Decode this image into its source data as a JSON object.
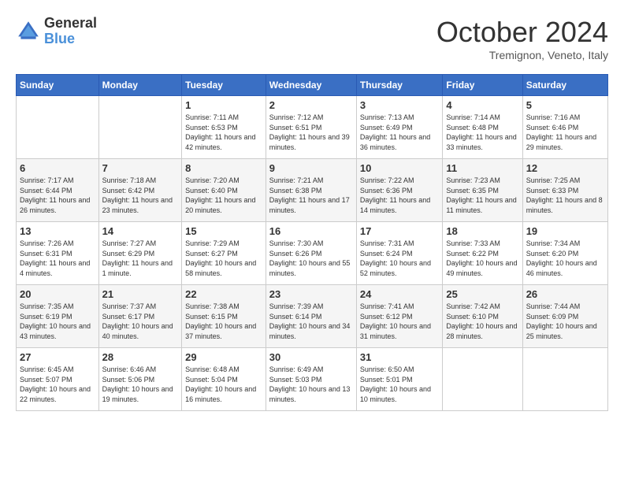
{
  "header": {
    "logo_general": "General",
    "logo_blue": "Blue",
    "title": "October 2024",
    "location": "Tremignon, Veneto, Italy"
  },
  "days_of_week": [
    "Sunday",
    "Monday",
    "Tuesday",
    "Wednesday",
    "Thursday",
    "Friday",
    "Saturday"
  ],
  "weeks": [
    [
      {
        "day": "",
        "sunrise": "",
        "sunset": "",
        "daylight": ""
      },
      {
        "day": "",
        "sunrise": "",
        "sunset": "",
        "daylight": ""
      },
      {
        "day": "1",
        "sunrise": "Sunrise: 7:11 AM",
        "sunset": "Sunset: 6:53 PM",
        "daylight": "Daylight: 11 hours and 42 minutes."
      },
      {
        "day": "2",
        "sunrise": "Sunrise: 7:12 AM",
        "sunset": "Sunset: 6:51 PM",
        "daylight": "Daylight: 11 hours and 39 minutes."
      },
      {
        "day": "3",
        "sunrise": "Sunrise: 7:13 AM",
        "sunset": "Sunset: 6:49 PM",
        "daylight": "Daylight: 11 hours and 36 minutes."
      },
      {
        "day": "4",
        "sunrise": "Sunrise: 7:14 AM",
        "sunset": "Sunset: 6:48 PM",
        "daylight": "Daylight: 11 hours and 33 minutes."
      },
      {
        "day": "5",
        "sunrise": "Sunrise: 7:16 AM",
        "sunset": "Sunset: 6:46 PM",
        "daylight": "Daylight: 11 hours and 29 minutes."
      }
    ],
    [
      {
        "day": "6",
        "sunrise": "Sunrise: 7:17 AM",
        "sunset": "Sunset: 6:44 PM",
        "daylight": "Daylight: 11 hours and 26 minutes."
      },
      {
        "day": "7",
        "sunrise": "Sunrise: 7:18 AM",
        "sunset": "Sunset: 6:42 PM",
        "daylight": "Daylight: 11 hours and 23 minutes."
      },
      {
        "day": "8",
        "sunrise": "Sunrise: 7:20 AM",
        "sunset": "Sunset: 6:40 PM",
        "daylight": "Daylight: 11 hours and 20 minutes."
      },
      {
        "day": "9",
        "sunrise": "Sunrise: 7:21 AM",
        "sunset": "Sunset: 6:38 PM",
        "daylight": "Daylight: 11 hours and 17 minutes."
      },
      {
        "day": "10",
        "sunrise": "Sunrise: 7:22 AM",
        "sunset": "Sunset: 6:36 PM",
        "daylight": "Daylight: 11 hours and 14 minutes."
      },
      {
        "day": "11",
        "sunrise": "Sunrise: 7:23 AM",
        "sunset": "Sunset: 6:35 PM",
        "daylight": "Daylight: 11 hours and 11 minutes."
      },
      {
        "day": "12",
        "sunrise": "Sunrise: 7:25 AM",
        "sunset": "Sunset: 6:33 PM",
        "daylight": "Daylight: 11 hours and 8 minutes."
      }
    ],
    [
      {
        "day": "13",
        "sunrise": "Sunrise: 7:26 AM",
        "sunset": "Sunset: 6:31 PM",
        "daylight": "Daylight: 11 hours and 4 minutes."
      },
      {
        "day": "14",
        "sunrise": "Sunrise: 7:27 AM",
        "sunset": "Sunset: 6:29 PM",
        "daylight": "Daylight: 11 hours and 1 minute."
      },
      {
        "day": "15",
        "sunrise": "Sunrise: 7:29 AM",
        "sunset": "Sunset: 6:27 PM",
        "daylight": "Daylight: 10 hours and 58 minutes."
      },
      {
        "day": "16",
        "sunrise": "Sunrise: 7:30 AM",
        "sunset": "Sunset: 6:26 PM",
        "daylight": "Daylight: 10 hours and 55 minutes."
      },
      {
        "day": "17",
        "sunrise": "Sunrise: 7:31 AM",
        "sunset": "Sunset: 6:24 PM",
        "daylight": "Daylight: 10 hours and 52 minutes."
      },
      {
        "day": "18",
        "sunrise": "Sunrise: 7:33 AM",
        "sunset": "Sunset: 6:22 PM",
        "daylight": "Daylight: 10 hours and 49 minutes."
      },
      {
        "day": "19",
        "sunrise": "Sunrise: 7:34 AM",
        "sunset": "Sunset: 6:20 PM",
        "daylight": "Daylight: 10 hours and 46 minutes."
      }
    ],
    [
      {
        "day": "20",
        "sunrise": "Sunrise: 7:35 AM",
        "sunset": "Sunset: 6:19 PM",
        "daylight": "Daylight: 10 hours and 43 minutes."
      },
      {
        "day": "21",
        "sunrise": "Sunrise: 7:37 AM",
        "sunset": "Sunset: 6:17 PM",
        "daylight": "Daylight: 10 hours and 40 minutes."
      },
      {
        "day": "22",
        "sunrise": "Sunrise: 7:38 AM",
        "sunset": "Sunset: 6:15 PM",
        "daylight": "Daylight: 10 hours and 37 minutes."
      },
      {
        "day": "23",
        "sunrise": "Sunrise: 7:39 AM",
        "sunset": "Sunset: 6:14 PM",
        "daylight": "Daylight: 10 hours and 34 minutes."
      },
      {
        "day": "24",
        "sunrise": "Sunrise: 7:41 AM",
        "sunset": "Sunset: 6:12 PM",
        "daylight": "Daylight: 10 hours and 31 minutes."
      },
      {
        "day": "25",
        "sunrise": "Sunrise: 7:42 AM",
        "sunset": "Sunset: 6:10 PM",
        "daylight": "Daylight: 10 hours and 28 minutes."
      },
      {
        "day": "26",
        "sunrise": "Sunrise: 7:44 AM",
        "sunset": "Sunset: 6:09 PM",
        "daylight": "Daylight: 10 hours and 25 minutes."
      }
    ],
    [
      {
        "day": "27",
        "sunrise": "Sunrise: 6:45 AM",
        "sunset": "Sunset: 5:07 PM",
        "daylight": "Daylight: 10 hours and 22 minutes."
      },
      {
        "day": "28",
        "sunrise": "Sunrise: 6:46 AM",
        "sunset": "Sunset: 5:06 PM",
        "daylight": "Daylight: 10 hours and 19 minutes."
      },
      {
        "day": "29",
        "sunrise": "Sunrise: 6:48 AM",
        "sunset": "Sunset: 5:04 PM",
        "daylight": "Daylight: 10 hours and 16 minutes."
      },
      {
        "day": "30",
        "sunrise": "Sunrise: 6:49 AM",
        "sunset": "Sunset: 5:03 PM",
        "daylight": "Daylight: 10 hours and 13 minutes."
      },
      {
        "day": "31",
        "sunrise": "Sunrise: 6:50 AM",
        "sunset": "Sunset: 5:01 PM",
        "daylight": "Daylight: 10 hours and 10 minutes."
      },
      {
        "day": "",
        "sunrise": "",
        "sunset": "",
        "daylight": ""
      },
      {
        "day": "",
        "sunrise": "",
        "sunset": "",
        "daylight": ""
      }
    ]
  ]
}
